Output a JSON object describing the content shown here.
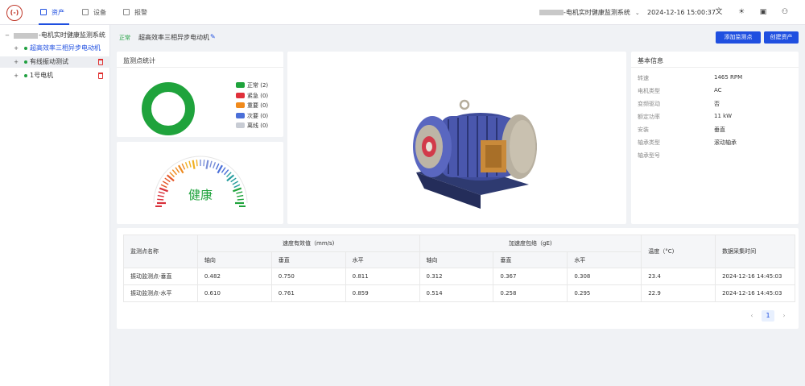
{
  "brand": {
    "logo_text": "(-)"
  },
  "nav": {
    "items": [
      {
        "label": "资产",
        "icon": "asset-icon"
      },
      {
        "label": "设备",
        "icon": "device-icon"
      },
      {
        "label": "报警",
        "icon": "alarm-icon"
      }
    ],
    "active_index": 0
  },
  "header": {
    "system_name": "-电机实时健康监测系统",
    "datetime": "2024-12-16 15:00:37"
  },
  "tree": {
    "root": "-电机实时健康监测系统",
    "items": [
      {
        "label": "超高效率三相异步电动机",
        "selected": false,
        "active_link": true
      },
      {
        "label": "有线振动测试",
        "selected": true,
        "deletable": true
      },
      {
        "label": "1号电机",
        "selected": false,
        "deletable": true
      }
    ]
  },
  "device": {
    "status": "正常",
    "title": "超高效率三相异步电动机"
  },
  "actions": {
    "add_point": "添加监测点",
    "create_asset": "创建资产"
  },
  "stats": {
    "title": "监测点统计",
    "legend": [
      {
        "label": "正常",
        "count": "(2)",
        "color": "#1fa33c"
      },
      {
        "label": "紧急",
        "count": "(0)",
        "color": "#e0303a"
      },
      {
        "label": "重要",
        "count": "(0)",
        "color": "#f08a1c"
      },
      {
        "label": "次要",
        "count": "(0)",
        "color": "#4a6fd8"
      },
      {
        "label": "离线",
        "count": "(0)",
        "color": "#c8ccd4"
      }
    ]
  },
  "health": {
    "label": "健康",
    "color": "#1fa33c"
  },
  "basic_info": {
    "title": "基本信息",
    "rows": [
      {
        "label": "转速",
        "value": "1465 RPM"
      },
      {
        "label": "电机类型",
        "value": "AC"
      },
      {
        "label": "变频驱动",
        "value": "否"
      },
      {
        "label": "额定功率",
        "value": "11 kW"
      },
      {
        "label": "安装",
        "value": "垂直"
      },
      {
        "label": "轴承类型",
        "value": "滚动轴承"
      },
      {
        "label": "轴承型号",
        "value": ""
      }
    ]
  },
  "table": {
    "col_name": "监测点名称",
    "group_velocity": "速度有效值（mm/s)",
    "group_accel": "加速度包络（gE)",
    "col_temp": "温度（°C)",
    "col_time": "数据采集时间",
    "sub_axial": "轴向",
    "sub_vertical": "垂直",
    "sub_horizontal": "水平",
    "rows": [
      {
        "name": "振动监测点-垂直",
        "v_axial": "0.482",
        "v_vert": "0.750",
        "v_horiz": "0.811",
        "a_axial": "0.312",
        "a_vert": "0.367",
        "a_horiz": "0.308",
        "temp": "23.4",
        "time": "2024-12-16 14:45:03"
      },
      {
        "name": "振动监测点-水平",
        "v_axial": "0.610",
        "v_vert": "0.761",
        "v_horiz": "0.859",
        "a_axial": "0.514",
        "a_vert": "0.258",
        "a_horiz": "0.295",
        "temp": "22.9",
        "time": "2024-12-16 14:45:03"
      }
    ]
  },
  "pagination": {
    "prev": "‹",
    "current": "1",
    "next": "›"
  }
}
